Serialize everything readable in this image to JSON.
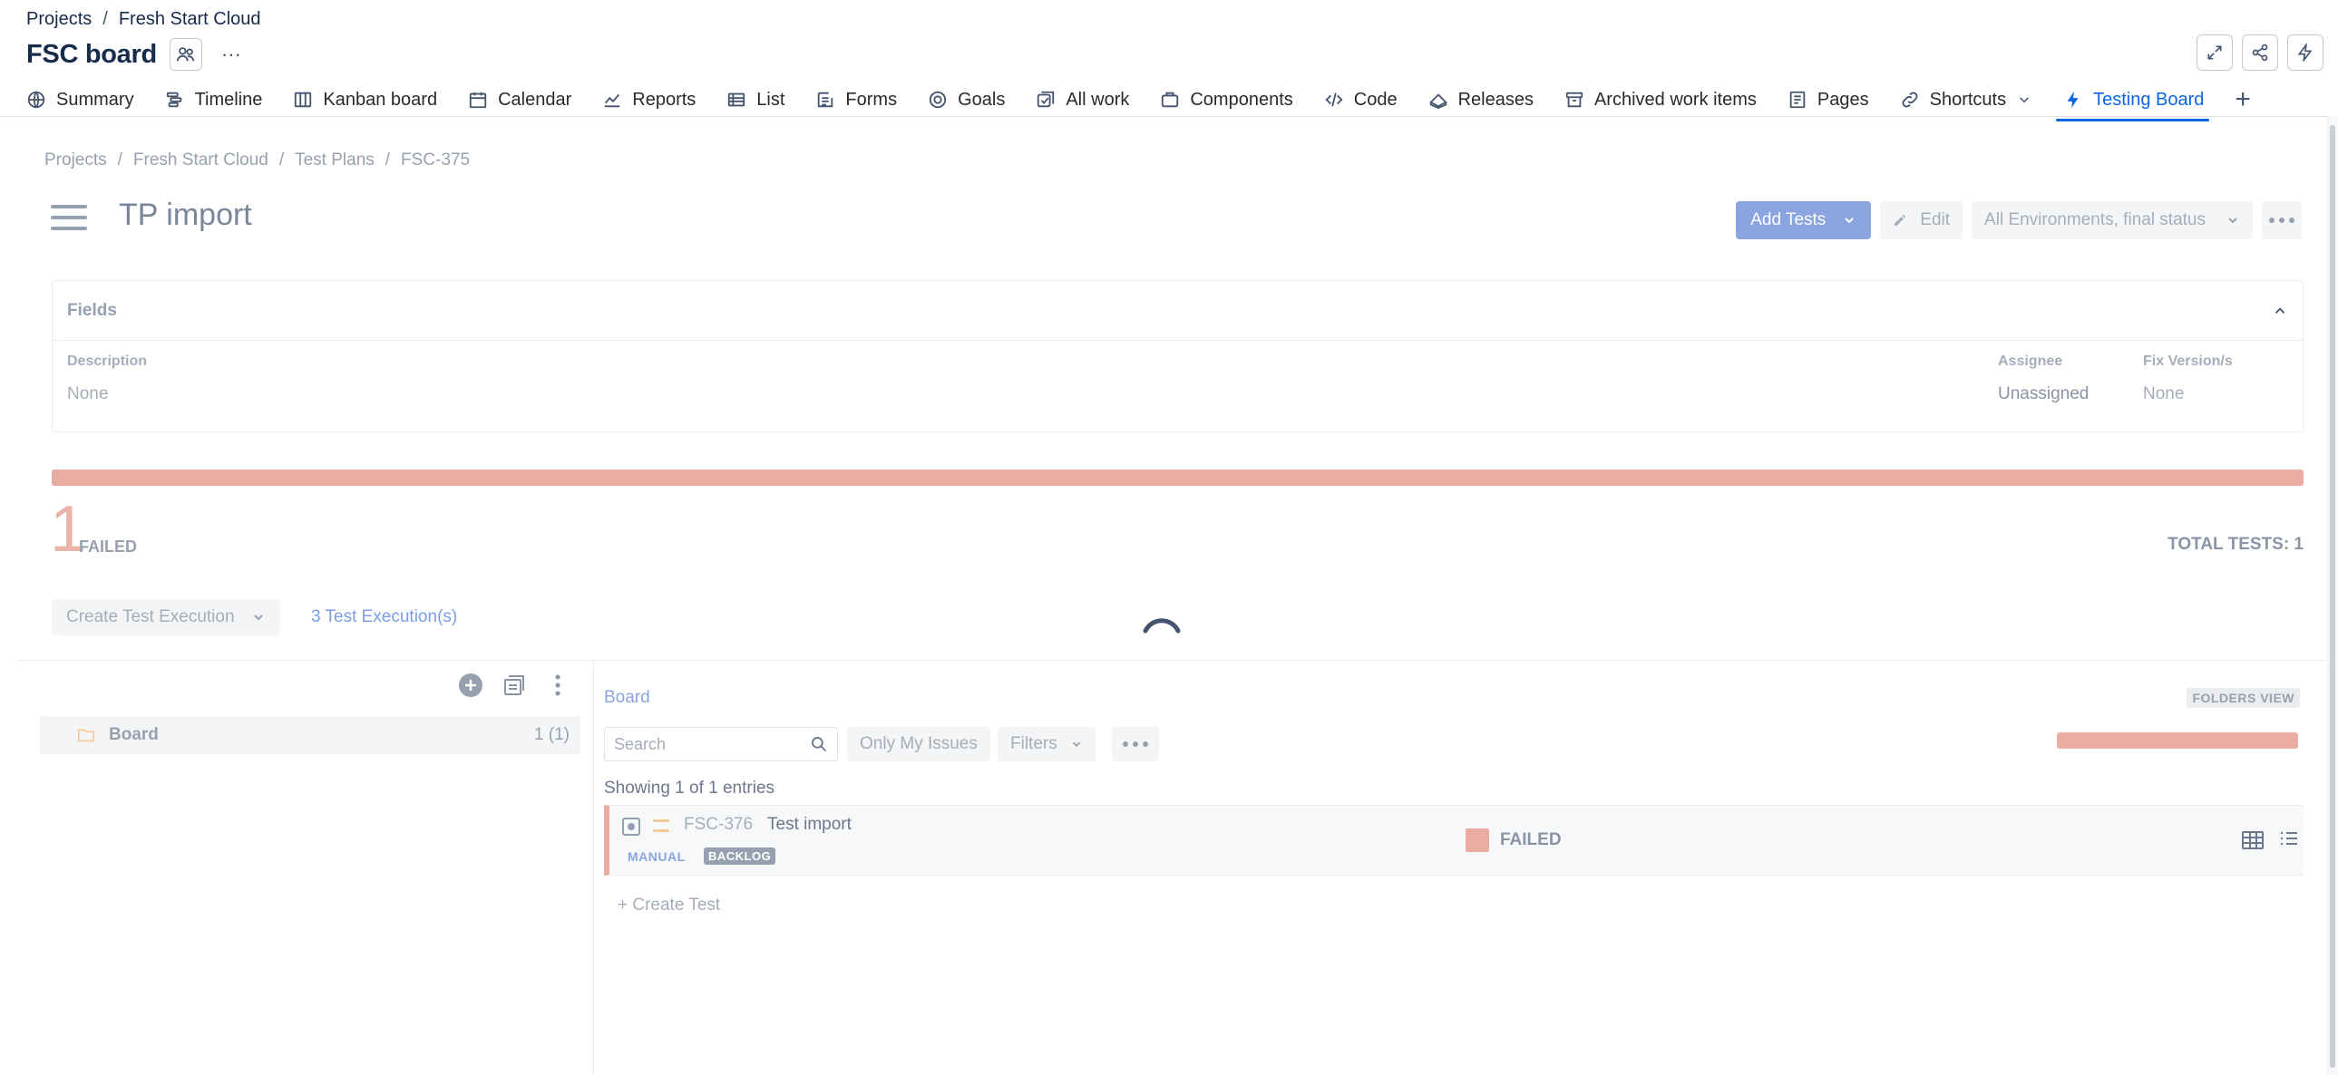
{
  "top_breadcrumb": {
    "root": "Projects",
    "sep": "/",
    "project": "Fresh Start Cloud"
  },
  "board": {
    "title": "FSC board",
    "more": "···"
  },
  "nav_tabs": [
    {
      "label": "Summary",
      "icon": "globe-icon"
    },
    {
      "label": "Timeline",
      "icon": "timeline-icon"
    },
    {
      "label": "Kanban board",
      "icon": "kanban-icon"
    },
    {
      "label": "Calendar",
      "icon": "calendar-icon"
    },
    {
      "label": "Reports",
      "icon": "reports-icon"
    },
    {
      "label": "List",
      "icon": "list-icon"
    },
    {
      "label": "Forms",
      "icon": "forms-icon"
    },
    {
      "label": "Goals",
      "icon": "goals-icon"
    },
    {
      "label": "All work",
      "icon": "all-work-icon"
    },
    {
      "label": "Components",
      "icon": "components-icon"
    },
    {
      "label": "Code",
      "icon": "code-icon"
    },
    {
      "label": "Releases",
      "icon": "releases-icon"
    },
    {
      "label": "Archived work items",
      "icon": "archive-icon"
    },
    {
      "label": "Pages",
      "icon": "pages-icon"
    },
    {
      "label": "Shortcuts",
      "icon": "link-icon"
    },
    {
      "label": "Testing Board",
      "icon": "lightning-icon"
    }
  ],
  "inner_breadcrumb": {
    "root": "Projects",
    "project": "Fresh Start Cloud",
    "section": "Test Plans",
    "key": "FSC-375",
    "sep": "/"
  },
  "plan": {
    "title": "TP import",
    "add_tests_label": "Add Tests",
    "edit_label": "Edit",
    "environment_label": "All Environments, final status"
  },
  "fields": {
    "heading": "Fields",
    "description_label": "Description",
    "description_value": "None",
    "assignee_label": "Assignee",
    "assignee_value": "Unassigned",
    "fix_version_label": "Fix Version/s",
    "fix_version_value": "None"
  },
  "progress": {
    "failed_fraction": 1.0,
    "color_failed": "#e8aca2"
  },
  "summary": {
    "failed_count": "1",
    "failed_word": "FAILED",
    "total_tests": "TOTAL TESTS: 1"
  },
  "executions": {
    "create_label": "Create Test Execution",
    "link_label": "3 Test Execution(s)"
  },
  "tree": {
    "folder_name": "Board",
    "folder_count": "1 (1)"
  },
  "board_panel": {
    "label": "Board",
    "folders_view": "FOLDERS VIEW",
    "search_placeholder": "Search",
    "only_my_issues": "Only My Issues",
    "filters": "Filters",
    "showing": "Showing 1 of 1 entries",
    "create_test": "+ Create Test"
  },
  "tests": [
    {
      "key": "FSC-376",
      "summary": "Test import",
      "type": "MANUAL",
      "workflow": "BACKLOG",
      "status": "FAILED"
    }
  ]
}
